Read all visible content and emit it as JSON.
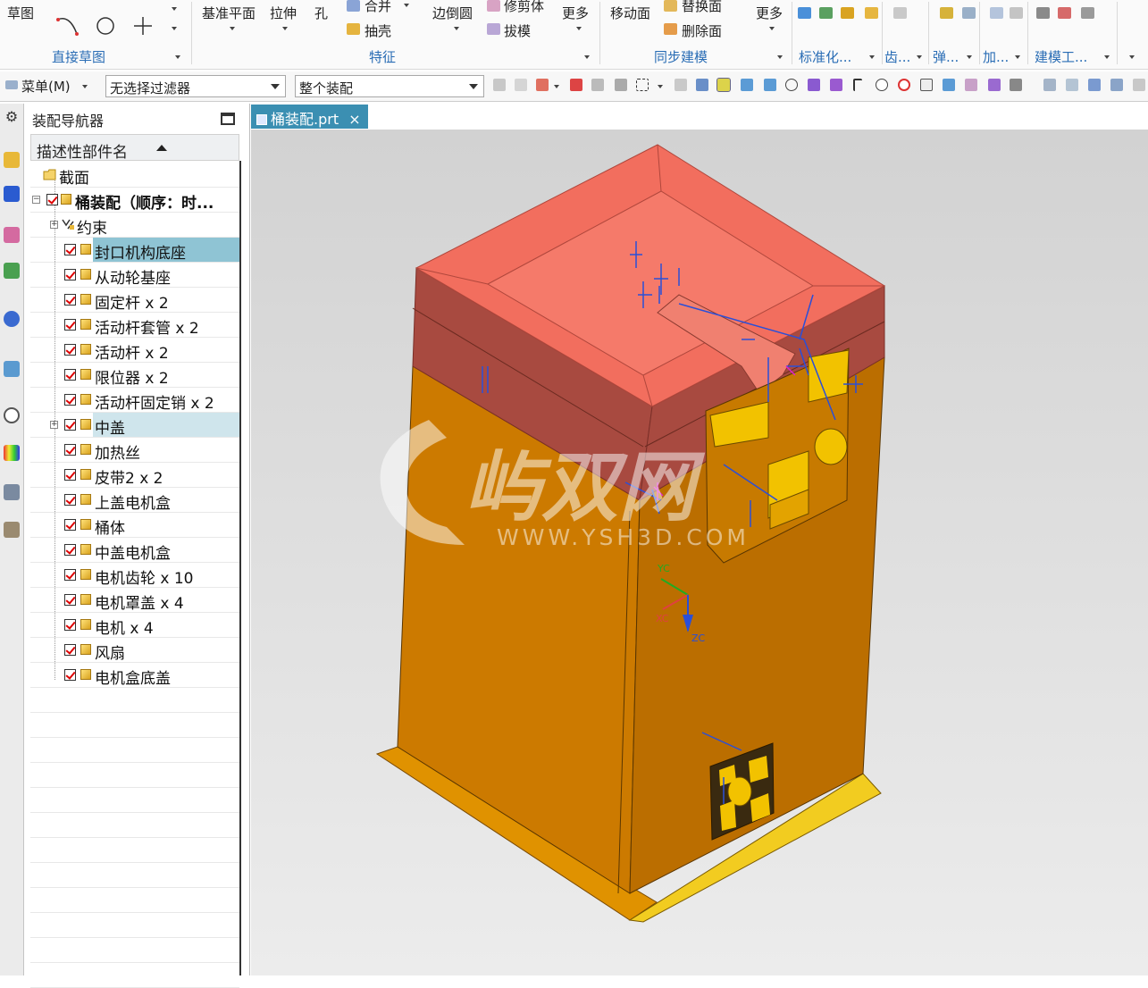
{
  "ribbon": {
    "sketch": {
      "label": "草图",
      "group": "直接草图"
    },
    "feature": {
      "datum_plane": "基准平面",
      "extrude": "拉伸",
      "hole": "孔",
      "unite": "合并",
      "shell": "抽壳",
      "edge_blend": "边倒圆",
      "trim_body": "修剪体",
      "draft": "拔模",
      "more": "更多",
      "group": "特征"
    },
    "sync": {
      "move_face": "移动面",
      "replace_face": "替换面",
      "delete_face": "删除面",
      "more": "更多",
      "group": "同步建模"
    },
    "groups_right": [
      "标准化...",
      "齿...",
      "弹...",
      "加...",
      "建模工..."
    ]
  },
  "toolbar": {
    "menu_label": "菜单(M)",
    "filter_value": "无选择过滤器",
    "scope_value": "整个装配"
  },
  "navigator": {
    "title": "装配导航器",
    "column_header": "描述性部件名",
    "section_label": "截面",
    "root_label": "桶装配（顺序：时...",
    "constraints_label": "约束",
    "parts": [
      {
        "label": "封口机构底座",
        "selected": true
      },
      {
        "label": "从动轮基座"
      },
      {
        "label": "固定杆 x 2"
      },
      {
        "label": "活动杆套管 x 2"
      },
      {
        "label": "活动杆 x 2"
      },
      {
        "label": "限位器 x 2"
      },
      {
        "label": "活动杆固定销 x 2"
      },
      {
        "label": "中盖",
        "hover": true,
        "expandable": true
      },
      {
        "label": "加热丝"
      },
      {
        "label": "皮带2 x 2"
      },
      {
        "label": "上盖电机盒"
      },
      {
        "label": "桶体"
      },
      {
        "label": "中盖电机盒"
      },
      {
        "label": "电机齿轮 x 10"
      },
      {
        "label": "电机罩盖 x 4"
      },
      {
        "label": "电机 x 4"
      },
      {
        "label": "风扇"
      },
      {
        "label": "电机盒底盖"
      }
    ]
  },
  "document_tab": {
    "label": "桶装配.prt",
    "close": "×"
  },
  "viewport": {
    "watermark_text": "WWW.YSH3D.COM",
    "watermark_brand": "屿双网",
    "axis_yc": "YC",
    "axis_xc": "XC",
    "axis_zc": "ZC",
    "colors": {
      "body": "#cc7a00",
      "lid": "#f07060",
      "accent": "#f2c200"
    }
  }
}
